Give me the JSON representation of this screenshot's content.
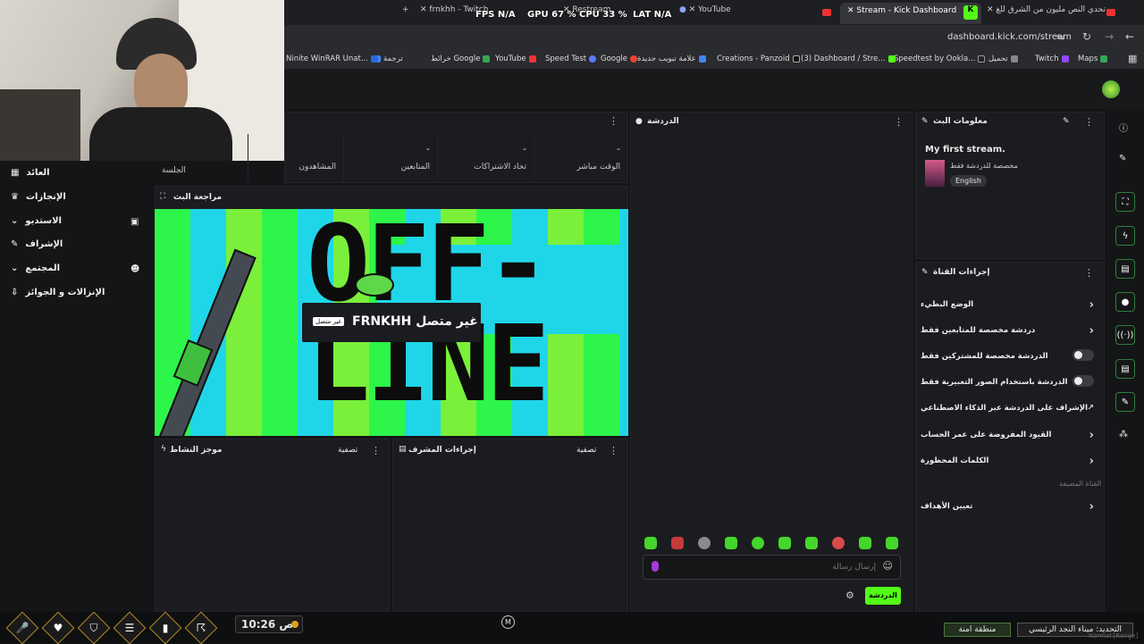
{
  "browser": {
    "tabs": [
      {
        "label": "frnkhh - Twitch"
      },
      {
        "label": "Restream"
      },
      {
        "label": "YouTube"
      },
      {
        "label": "Stream - Kick Dashboard"
      },
      {
        "label": "تحدي النص مليون من الشرق للغ"
      }
    ],
    "url": "dashboard.kick.com/stream",
    "bookmarks": [
      "Maps",
      "Twitch",
      "تحميل",
      "Speedtest by Ookla...",
      "(3) Dashboard / Stre...",
      "Creations - Panzoid",
      "علامة تبويب جديدة",
      "Google",
      "Speed Test",
      "YouTube",
      "خرائط Google",
      "ترجمة",
      "Ninite WinRAR Unat..."
    ]
  },
  "overlay": {
    "fps_label": "FPS",
    "fps": "N/A",
    "gpu_label": "GPU",
    "gpu": "67 %",
    "cpu_label": "CPU",
    "cpu": "33 %",
    "lat_label": "LAT",
    "lat": "N/A"
  },
  "sidebar": {
    "items": [
      {
        "label": "العائد"
      },
      {
        "label": "الإنجازات"
      },
      {
        "label": "الاستديو"
      },
      {
        "label": "الإشراف"
      },
      {
        "label": "المجتمع"
      },
      {
        "label": "الإنزالات و الجوائز"
      }
    ]
  },
  "stats": [
    {
      "label": "الوقت مباشر",
      "value": "-"
    },
    {
      "label": "تحاد الاشتراكات",
      "value": "-"
    },
    {
      "label": "المتابعين",
      "value": "-"
    },
    {
      "label": "المشاهدون",
      "value": ""
    },
    {
      "label": "الجلسة",
      "value": ""
    }
  ],
  "preview": {
    "title": "مراجعة البث",
    "offline_text": "OFF-LINE",
    "name": "FRNKHH غير متصل",
    "badge": "غير متصل"
  },
  "panels": {
    "activity": "موجز النشاط",
    "activity_filter": "تصفية",
    "mod": "إجراءات المشرف",
    "mod_filter": "تصفية"
  },
  "chat": {
    "title": "الدردشة",
    "placeholder": "إرسال رسالة",
    "send": "الدردشة"
  },
  "stream_info": {
    "title": "معلومات البث",
    "stream_title": "My first stream.",
    "category": "مخصصة للدردشة فقط",
    "language": "English"
  },
  "channel_actions": {
    "title": "إجراءات القناة",
    "rows": [
      {
        "label": "الوضع البطيء",
        "control": "chevron"
      },
      {
        "label": "دردشة مخصصة للمتابعين فقط",
        "control": "chevron"
      },
      {
        "label": "الدردشة مخصصة للمشتركين فقط",
        "control": "toggle"
      },
      {
        "label": "الدردشة باستخدام الصور التعبيرية فقط",
        "control": "toggle"
      },
      {
        "label": "الإشراف على الدردشة عبر الذكاء الاصطناعي",
        "control": "external"
      },
      {
        "label": "القيود المفروضة على عمر الحساب",
        "control": "chevron"
      },
      {
        "label": "الكلمات المحظورة",
        "control": "chevron"
      }
    ],
    "section": "القناة المضيفة",
    "goals": "تعيين الأهداف"
  },
  "game_hud": {
    "time": "10:26 ص",
    "safe_zone": "منطقة امنة",
    "location": "التحديد: ميناء النجد الرئيسي",
    "mode": "Normal [Range]",
    "mic_key": "M"
  }
}
